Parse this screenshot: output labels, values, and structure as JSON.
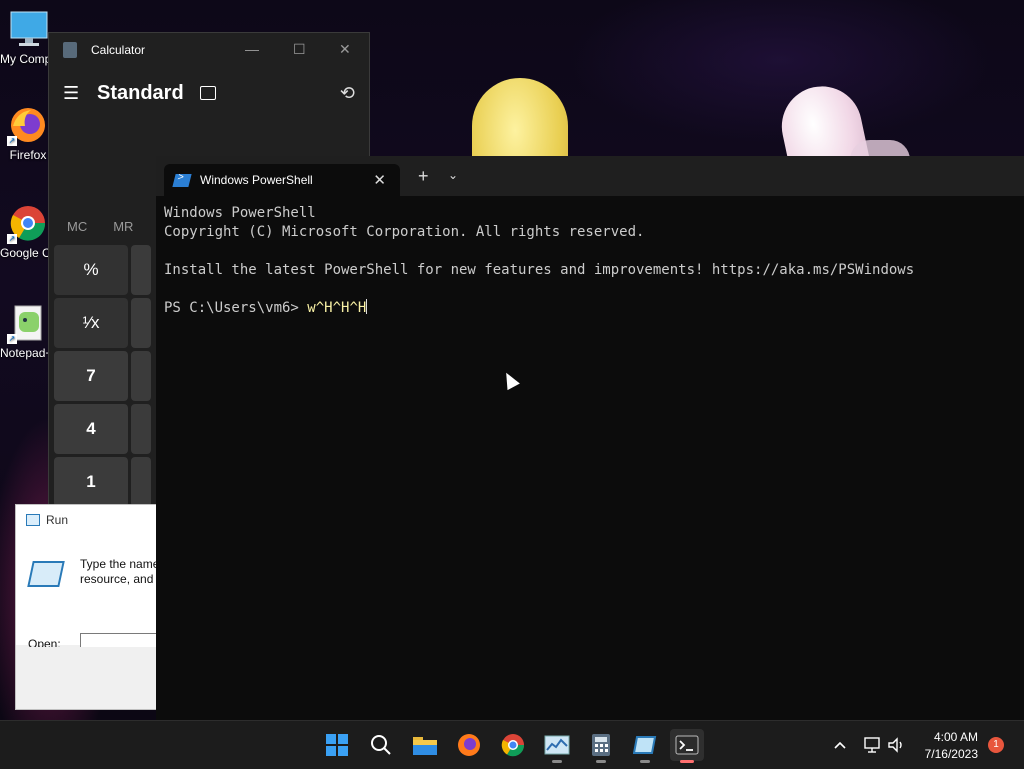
{
  "desktop": {
    "icons": [
      {
        "label": "My Computer",
        "icon": "monitor-icon"
      },
      {
        "label": "Firefox",
        "icon": "firefox-icon"
      },
      {
        "label": "Google Chrome",
        "icon": "chrome-icon"
      },
      {
        "label": "Notepad++",
        "icon": "notepad-icon"
      }
    ]
  },
  "calculator": {
    "title": "Calculator",
    "mode": "Standard",
    "memory": [
      "MC",
      "MR"
    ],
    "keys": {
      "percent": "%",
      "reciprocal": "¹⁄x",
      "seven": "7",
      "four": "4",
      "one": "1"
    }
  },
  "run_dialog": {
    "title": "Run",
    "description_line1": "Type the name",
    "description_line2": "resource, and W",
    "open_label": "Open:",
    "open_value": ""
  },
  "terminal": {
    "tab_title": "Windows PowerShell",
    "lines": [
      "Windows PowerShell",
      "Copyright (C) Microsoft Corporation. All rights reserved.",
      "",
      "Install the latest PowerShell for new features and improvements! https://aka.ms/PSWindows",
      ""
    ],
    "prompt": "PS C:\\Users\\vm6> ",
    "command": "w^H^H^H"
  },
  "taskbar": {
    "apps": [
      "start-icon",
      "search-icon",
      "file-explorer-icon",
      "firefox-icon",
      "chrome-icon",
      "task-manager-icon",
      "calculator-icon",
      "run-icon",
      "terminal-icon"
    ],
    "time": "4:00 AM",
    "date": "7/16/2023",
    "notification_count": "1"
  }
}
